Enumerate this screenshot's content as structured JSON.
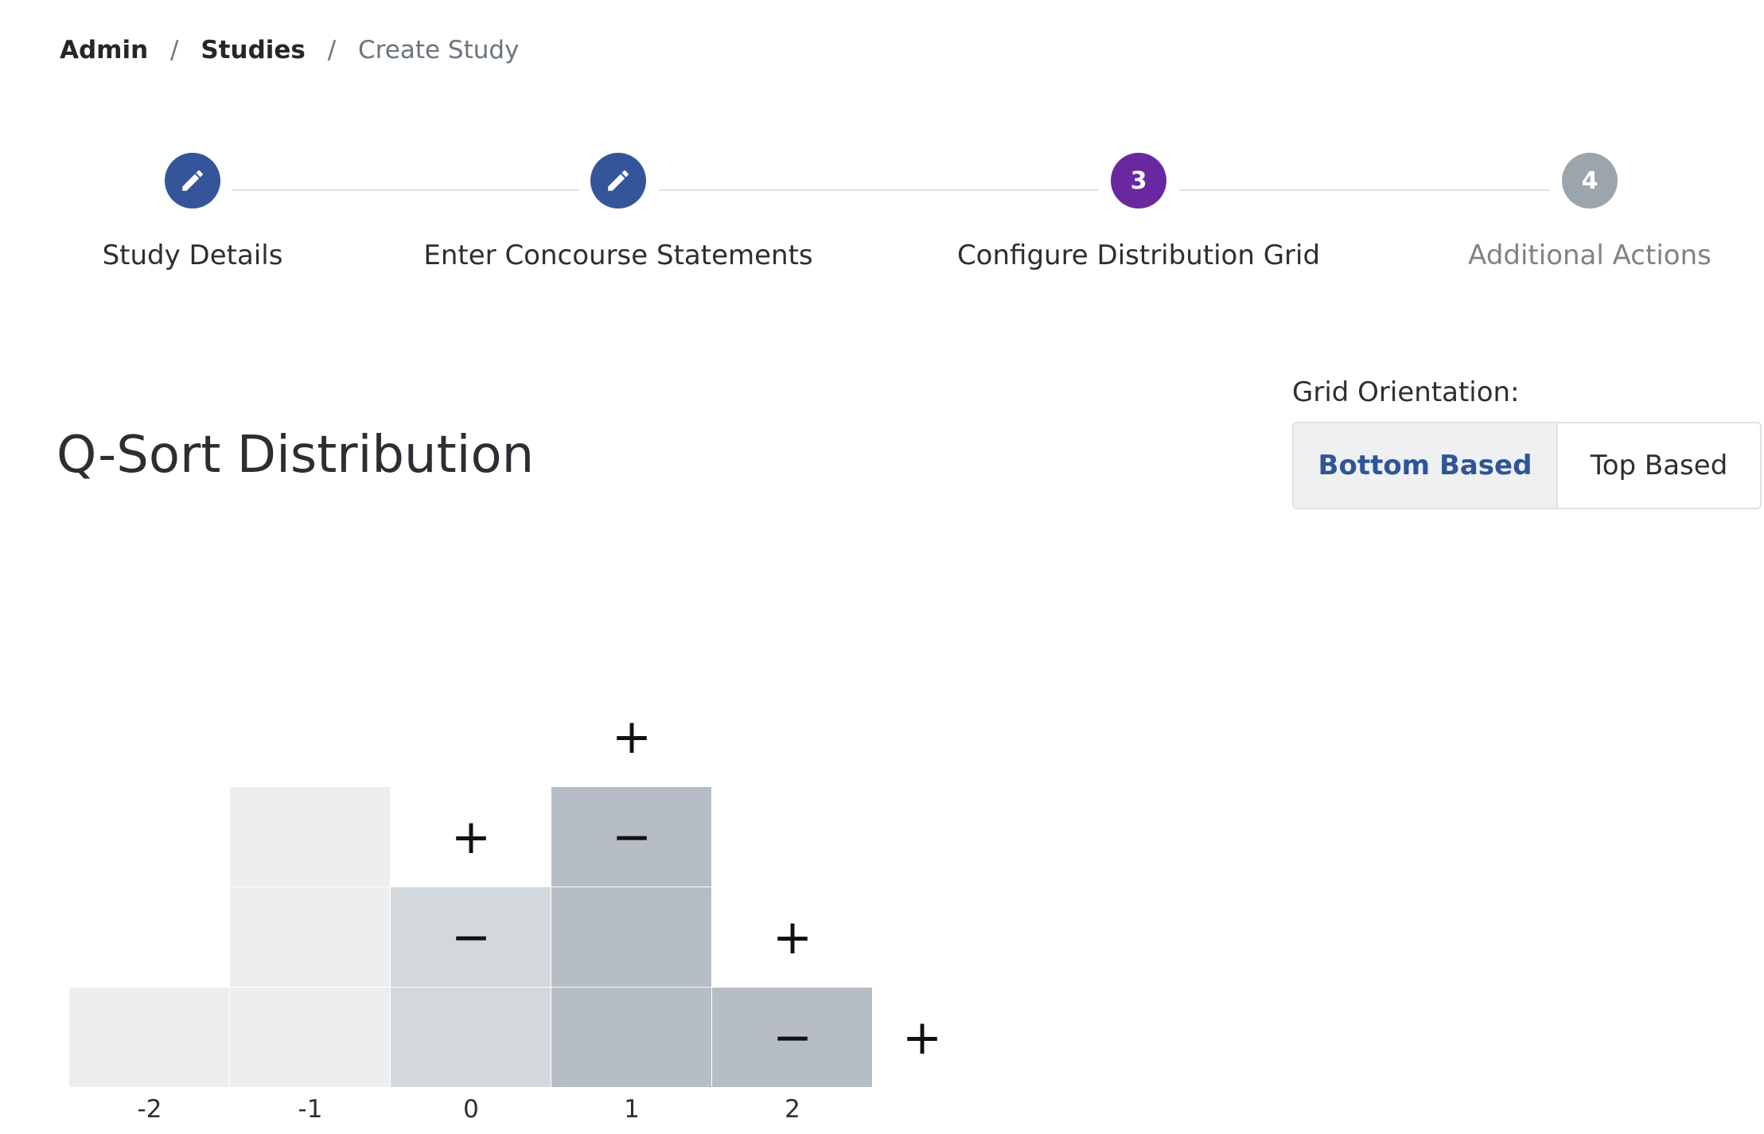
{
  "breadcrumb": {
    "items": [
      "Admin",
      "Studies"
    ],
    "current": "Create Study",
    "separator": "/"
  },
  "stepper": {
    "steps": [
      {
        "label": "Study Details",
        "state": "completed",
        "icon": "pencil-icon"
      },
      {
        "label": "Enter Concourse Statements",
        "state": "completed",
        "icon": "pencil-icon"
      },
      {
        "label": "Configure Distribution Grid",
        "state": "active",
        "number": "3"
      },
      {
        "label": "Additional Actions",
        "state": "pending",
        "number": "4"
      }
    ],
    "colors": {
      "completed": "#34559a",
      "active": "#6a28a0",
      "pending": "#9aa5ae"
    }
  },
  "page_title": "Q-Sort Distribution",
  "grid_orientation": {
    "label": "Grid Orientation:",
    "options": [
      "Bottom Based",
      "Top Based"
    ],
    "selected": "Bottom Based"
  },
  "distribution": {
    "columns": [
      {
        "label": "-2",
        "cells": 1,
        "color": "#edeef0",
        "controls": false
      },
      {
        "label": "-1",
        "cells": 3,
        "color": "#edeef0",
        "controls": false
      },
      {
        "label": "0",
        "cells": 2,
        "color": "#d3d8dc",
        "controls": true
      },
      {
        "label": "1",
        "cells": 3,
        "color": "#b6bdc4",
        "controls": true
      },
      {
        "label": "2",
        "cells": 1,
        "color": "#b6bdc4",
        "controls": true
      }
    ],
    "plus_symbol": "+",
    "minus_symbol": "−"
  }
}
